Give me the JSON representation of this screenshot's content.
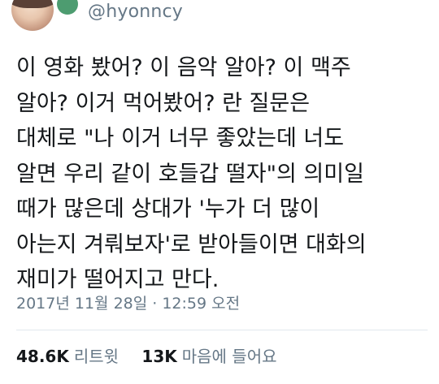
{
  "author": {
    "handle": "@hyonncy",
    "avatar": "profile-photo",
    "badge_color": "#2e8b57"
  },
  "tweet": {
    "text": "이 영화 봤어? 이 음악 알아? 이 맥주\n알아? 이거 먹어봤어? 란 질문은\n대체로 \"나 이거 너무 좋았는데 너도\n알면 우리 같이 호들갑 떨자\"의 의미일\n때가 많은데 상대가 '누가 더 많이\n아는지 겨뤄보자'로 받아들이면 대화의\n재미가 떨어지고 만다.",
    "timestamp": "2017년 11월 28일 · 12:59 오전"
  },
  "stats": {
    "retweets_count": "48.6K",
    "retweets_label": "리트윗",
    "likes_count": "13K",
    "likes_label": "마음에 들어요"
  },
  "colors": {
    "text": "#14171a",
    "muted": "#657786",
    "divider": "#e1e8ed"
  }
}
